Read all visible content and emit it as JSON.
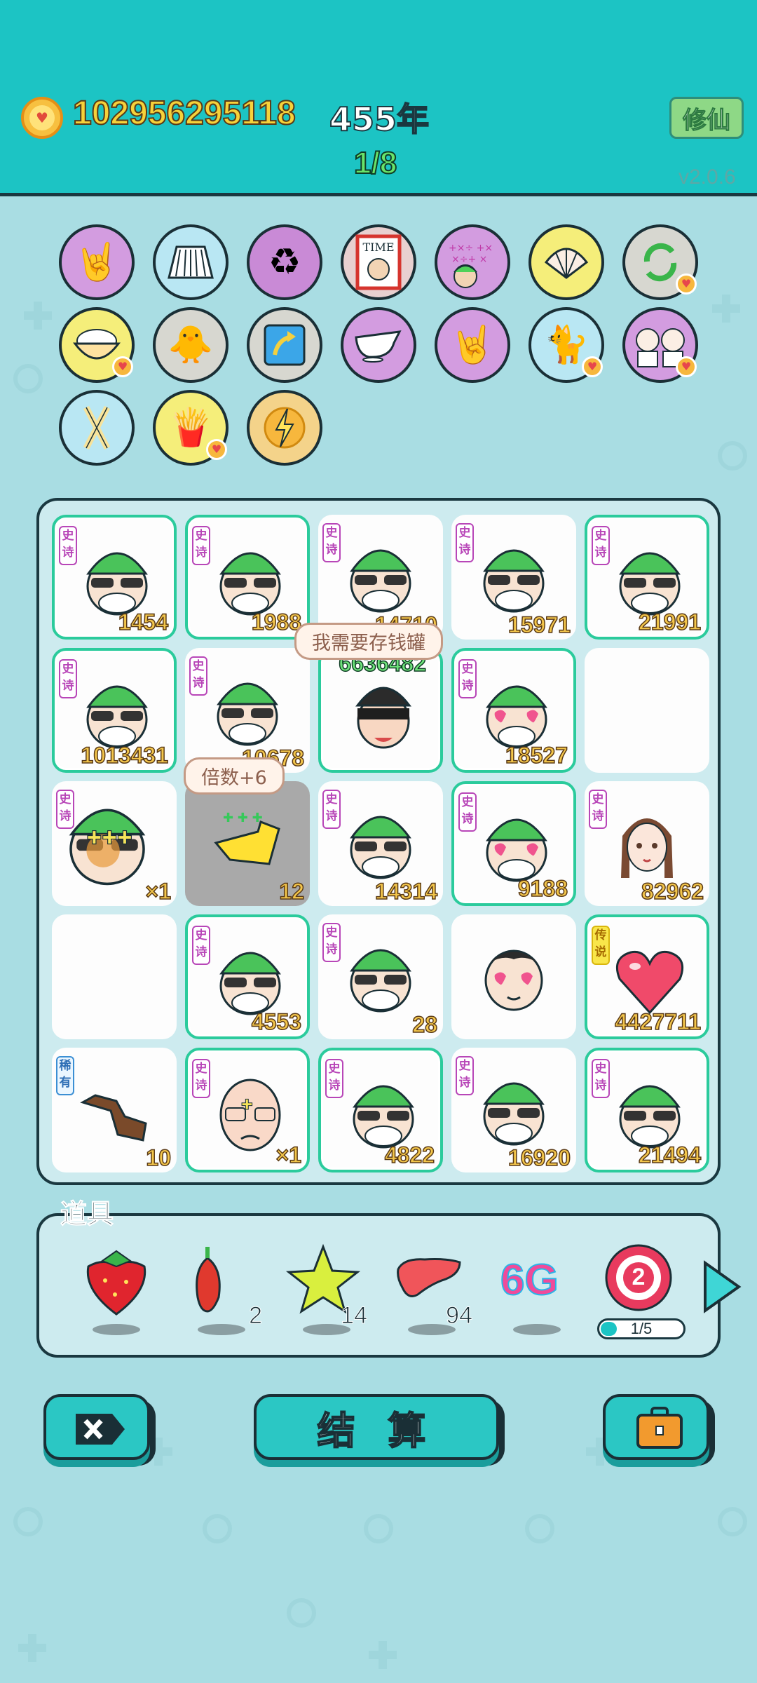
{
  "header": {
    "coins": "102956295118",
    "years": "455年",
    "progress": "1/8",
    "xiuxian_label": "修仙",
    "version": "v2.0.6"
  },
  "buffs": [
    {
      "icon": "rock-hand-icon"
    },
    {
      "icon": "pleated-skirt-icon"
    },
    {
      "icon": "recycle-icon"
    },
    {
      "icon": "time-magazine-icon"
    },
    {
      "icon": "confused-math-face-icon"
    },
    {
      "icon": "seashell-icon"
    },
    {
      "icon": "refresh-arrows-icon"
    },
    {
      "icon": "rice-bowl-icon"
    },
    {
      "icon": "chick-egg-icon"
    },
    {
      "icon": "arrow-box-icon"
    },
    {
      "icon": "gravy-boat-icon"
    },
    {
      "icon": "rock-hand-icon"
    },
    {
      "icon": "cat-icon"
    },
    {
      "icon": "twins-icon"
    },
    {
      "icon": "crossed-sticks-icon"
    },
    {
      "icon": "french-fries-icon"
    },
    {
      "icon": "lightning-icon"
    }
  ],
  "board": {
    "tag_epic": "史诗",
    "tag_legend": "传说",
    "tag_rare": "稀有",
    "cells": [
      {
        "num": "1454"
      },
      {
        "num": "1988"
      },
      {
        "num": "14710"
      },
      {
        "num": "15971"
      },
      {
        "num": "21991"
      },
      {
        "num": "1013431"
      },
      {
        "num": "10678"
      },
      {
        "num": "6636482"
      },
      {
        "num": "18527"
      },
      {
        "num": ""
      },
      {
        "num": "×1"
      },
      {
        "num": "12"
      },
      {
        "num": "14314"
      },
      {
        "num": "9188"
      },
      {
        "num": "82962"
      },
      {
        "num": ""
      },
      {
        "num": "4553"
      },
      {
        "num": "28"
      },
      {
        "num": ""
      },
      {
        "num": "4427711"
      },
      {
        "num": "10"
      },
      {
        "num": "×1"
      },
      {
        "num": "4822"
      },
      {
        "num": "16920"
      },
      {
        "num": "21494"
      }
    ],
    "bubble_piggy": "我需要存钱罐",
    "bubble_multiplier": "倍数+6"
  },
  "props": {
    "title": "道具",
    "items": [
      {
        "icon": "strawberry-icon",
        "count": ""
      },
      {
        "icon": "chili-pepper-icon",
        "count": "2"
      },
      {
        "icon": "star-icon",
        "count": "14"
      },
      {
        "icon": "liver-icon",
        "count": "94"
      },
      {
        "icon": "6g-icon",
        "label": "6G",
        "count": ""
      },
      {
        "icon": "target-icon",
        "label": "2",
        "count": ""
      }
    ],
    "target_progress_text": "1/5",
    "target_progress": 0.2
  },
  "buttons": {
    "settle_label": "结 算"
  }
}
